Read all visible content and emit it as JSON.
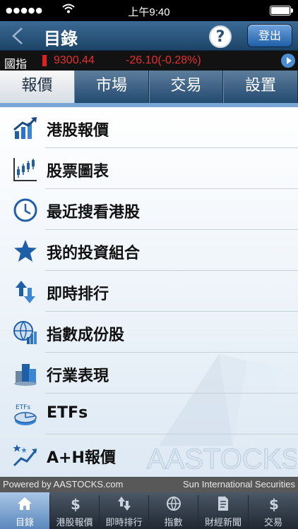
{
  "status_bar": {
    "signal": "●●●●●",
    "time": "上午9:40"
  },
  "nav": {
    "title": "目錄",
    "help": "?",
    "logout_label": "登出"
  },
  "ticker": {
    "label": "國指",
    "value": "9300.44",
    "change": "-26.10(-0.28%)",
    "color": "#e63030"
  },
  "tabs": [
    {
      "label": "報價",
      "active": true
    },
    {
      "label": "市場",
      "active": false
    },
    {
      "label": "交易",
      "active": false
    },
    {
      "label": "設置",
      "active": false
    }
  ],
  "menu": [
    {
      "label": "港股報價",
      "icon": "chart-up-icon"
    },
    {
      "label": "股票圖表",
      "icon": "candlestick-icon"
    },
    {
      "label": "最近搜看港股",
      "icon": "clock-icon"
    },
    {
      "label": "我的投資組合",
      "icon": "star-icon"
    },
    {
      "label": "即時排行",
      "icon": "up-down-arrows-icon"
    },
    {
      "label": "指數成份股",
      "icon": "globe-chart-icon"
    },
    {
      "label": "行業表現",
      "icon": "buildings-icon"
    },
    {
      "label": "ETFs",
      "icon": "etf-icon"
    },
    {
      "label": "A+H報價",
      "icon": "stars-chart-icon"
    }
  ],
  "watermark": "AASTOCKS",
  "footer": {
    "powered": "Powered by AASTOCKS.com",
    "broker": "Sun International Securities"
  },
  "bottom_tabs": [
    {
      "label": "目錄",
      "icon": "home-icon",
      "active": true
    },
    {
      "label": "港股報價",
      "icon": "dollar-icon",
      "active": false
    },
    {
      "label": "即時排行",
      "icon": "up-down-arrows-icon",
      "active": false
    },
    {
      "label": "指數",
      "icon": "globe-icon",
      "active": false
    },
    {
      "label": "財經新聞",
      "icon": "document-icon",
      "active": false
    },
    {
      "label": "交易",
      "icon": "dollar-icon",
      "active": false
    }
  ],
  "colors": {
    "accent": "#1f5fa8",
    "tab_underline": "#7aa6d6",
    "icon_blue": "#1f5fa8"
  }
}
